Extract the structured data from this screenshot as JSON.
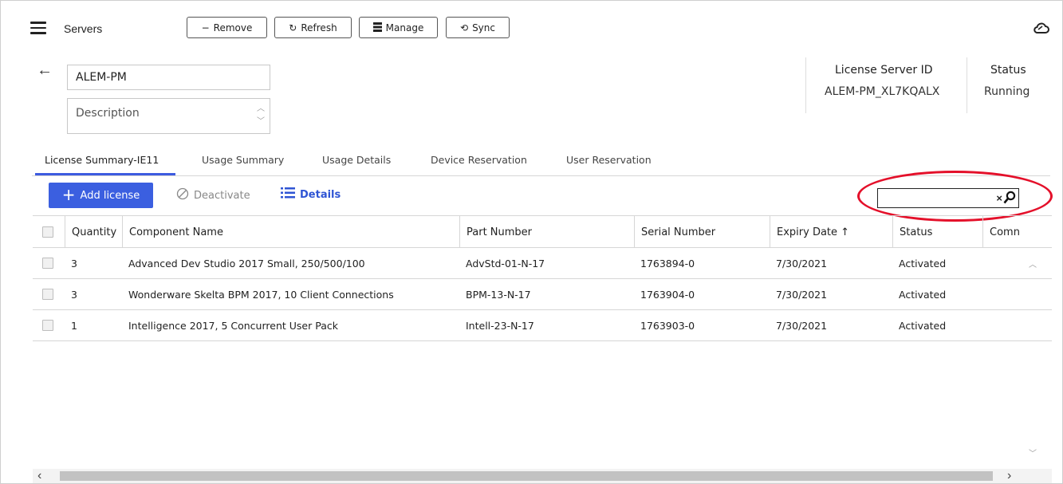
{
  "toolbar": {
    "title": "Servers",
    "buttons": [
      {
        "icon": "minus",
        "label": "Remove"
      },
      {
        "icon": "refresh",
        "label": "Refresh"
      },
      {
        "icon": "server-stack",
        "label": "Manage"
      },
      {
        "icon": "sync",
        "label": "Sync"
      }
    ],
    "cloud_icon": "cloud-icon"
  },
  "server": {
    "name_value": "ALEM-PM",
    "description_placeholder": "Description",
    "license_server_id_label": "License Server ID",
    "license_server_id_value": "ALEM-PM_XL7KQALX",
    "status_label": "Status",
    "status_value": "Running"
  },
  "tabs": [
    {
      "label": "License Summary-IE11",
      "active": true
    },
    {
      "label": "Usage Summary",
      "active": false
    },
    {
      "label": "Usage Details",
      "active": false
    },
    {
      "label": "Device Reservation",
      "active": false
    },
    {
      "label": "User Reservation",
      "active": false
    }
  ],
  "actions": {
    "add_label": "Add license",
    "deactivate_label": "Deactivate",
    "details_label": "Details",
    "search_clear": "×"
  },
  "table": {
    "columns": [
      "Quantity",
      "Component Name",
      "Part Number",
      "Serial Number",
      "Expiry Date ↑",
      "Status",
      "Comn"
    ],
    "rows": [
      {
        "quantity": "3",
        "component": "Advanced Dev Studio 2017 Small, 250/500/100",
        "part": "AdvStd-01-N-17",
        "serial": "1763894-0",
        "expiry": "7/30/2021",
        "status": "Activated"
      },
      {
        "quantity": "3",
        "component": "Wonderware Skelta BPM 2017, 10 Client Connections",
        "part": "BPM-13-N-17",
        "serial": "1763904-0",
        "expiry": "7/30/2021",
        "status": "Activated"
      },
      {
        "quantity": "1",
        "component": "Intelligence 2017, 5 Concurrent User Pack",
        "part": "Intell-23-N-17",
        "serial": "1763903-0",
        "expiry": "7/30/2021",
        "status": "Activated"
      }
    ]
  },
  "colors": {
    "accent": "#3b5fe0",
    "highlight_oval": "#e4102a"
  }
}
